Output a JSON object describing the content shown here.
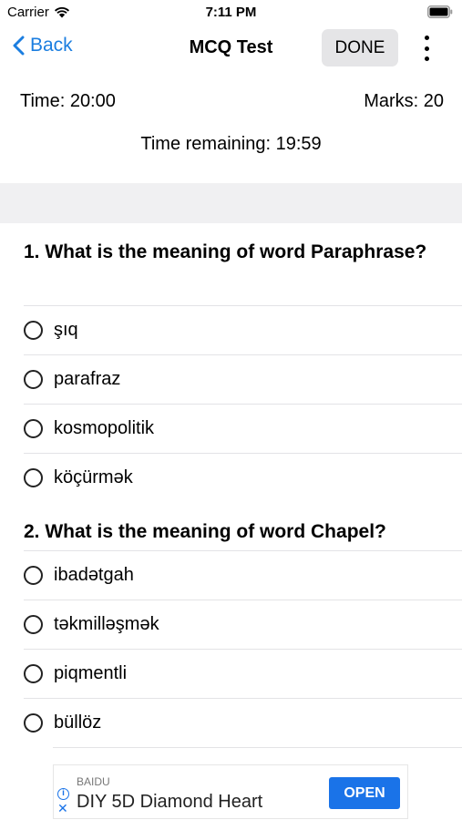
{
  "status_bar": {
    "carrier": "Carrier",
    "time": "7:11 PM"
  },
  "nav": {
    "back_label": "Back",
    "title": "MCQ Test",
    "done_label": "DONE"
  },
  "info": {
    "time_label": "Time: 20:00",
    "marks_label": "Marks: 20",
    "remaining_label": "Time remaining: 19:59"
  },
  "questions": [
    {
      "text": "1. What is the meaning of word Paraphrase?",
      "options": [
        "şıq",
        "parafraz",
        "kosmopolitik",
        "köçürmək"
      ]
    },
    {
      "text": "2. What is the meaning of word Chapel?",
      "options": [
        "ibadətgah",
        "təkmilləşmək",
        "piqmentli",
        "büllöz"
      ]
    }
  ],
  "ad": {
    "source": "BAIDU",
    "title": "DIY 5D Diamond Heart",
    "button": "OPEN"
  },
  "colors": {
    "accent": "#1b7ee0",
    "ad_button": "#1a73e8",
    "band": "#f0f0f2"
  }
}
